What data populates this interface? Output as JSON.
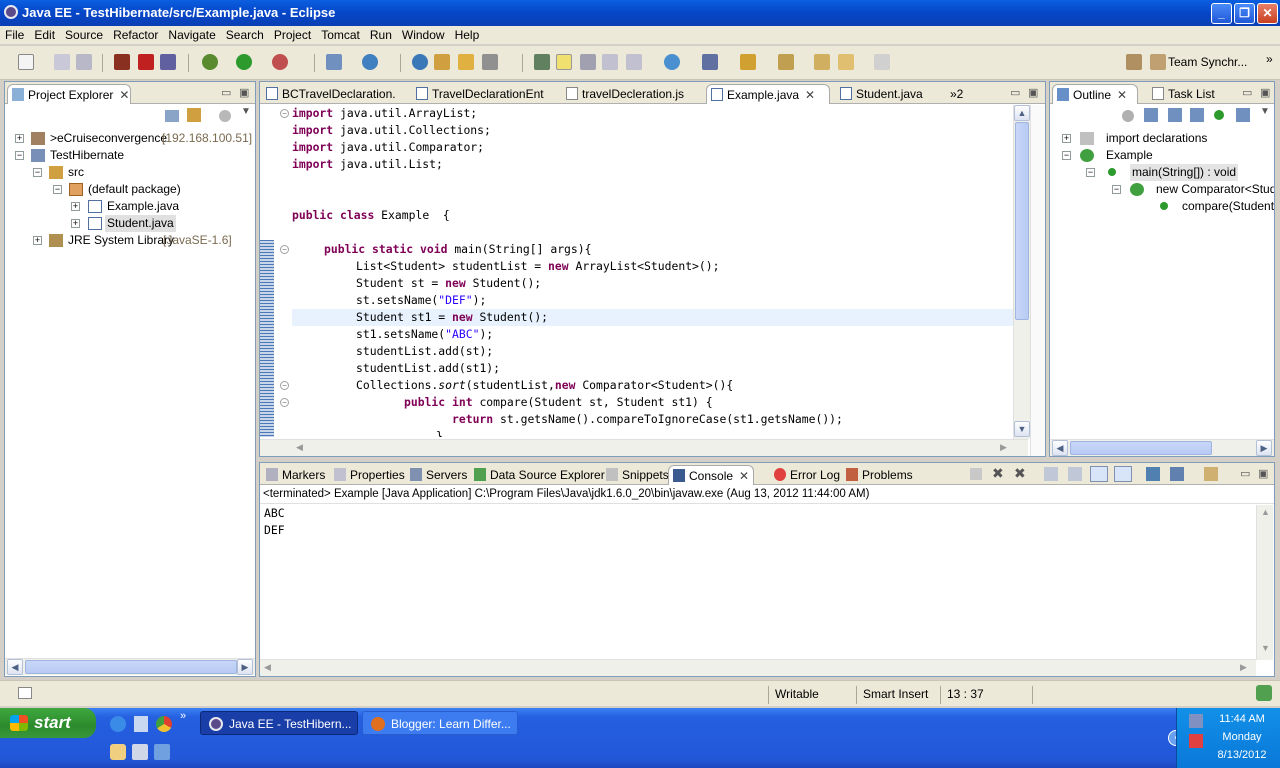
{
  "window": {
    "title": "Java EE - TestHibernate/src/Example.java - Eclipse"
  },
  "menu": [
    "File",
    "Edit",
    "Source",
    "Refactor",
    "Navigate",
    "Search",
    "Project",
    "Tomcat",
    "Run",
    "Window",
    "Help"
  ],
  "toolbar": {
    "team_sync": "Team Synchr..."
  },
  "project_explorer": {
    "title": "Project Explorer",
    "items": [
      {
        "label": ">eCruiseconvergence",
        "suffix": "[192.168.100.51]"
      },
      {
        "label": "TestHibernate"
      },
      {
        "label": "src"
      },
      {
        "label": "(default package)"
      },
      {
        "label": "Example.java"
      },
      {
        "label": "Student.java"
      },
      {
        "label": "JRE System Library",
        "suffix": "[JavaSE-1.6]"
      }
    ]
  },
  "editor_tabs": [
    {
      "label": "BCTravelDeclaration."
    },
    {
      "label": "TravelDeclarationEnt"
    },
    {
      "label": "travelDecleration.js"
    },
    {
      "label": "Example.java"
    },
    {
      "label": "Student.java"
    },
    {
      "label": "»2"
    }
  ],
  "code": {
    "l1a": "import",
    "l1b": " java.util.ArrayList;",
    "l2a": "import",
    "l2b": " java.util.Collections;",
    "l3a": "import",
    "l3b": " java.util.Comparator;",
    "l4a": "import",
    "l4b": " java.util.List;",
    "l6a": "public",
    "l6b": "class",
    "l6c": " Example  {",
    "l8a": "public",
    "l8b": "static",
    "l8c": "void",
    "l8d": " main(String[] args){",
    "l9a": "List<Student> studentList = ",
    "l9b": "new",
    "l9c": " ArrayList<Student>();",
    "l10a": "Student st = ",
    "l10b": "new",
    "l10c": " Student();",
    "l11a": "st.setsName(",
    "l11b": "\"DEF\"",
    "l11c": ");",
    "l12a": "Student st1 = ",
    "l12b": "new",
    "l12c": " Student();",
    "l13a": "st1.setsName(",
    "l13b": "\"ABC\"",
    "l13c": ");",
    "l14": "studentList.add(st);",
    "l15": "studentList.add(st1);",
    "l16a": "Collections.",
    "l16b": "sort",
    "l16c": "(studentList,",
    "l16d": "new",
    "l16e": " Comparator<Student>(){",
    "l17a": "public",
    "l17b": "int",
    "l17c": " compare(Student st, Student st1) {",
    "l18a": "return",
    "l18b": " st.getsName().compareToIgnoreCase(st1.getsName());",
    "l19": "}"
  },
  "outline": {
    "tab": "Outline",
    "tasklist": "Task List",
    "items": [
      {
        "label": "import declarations"
      },
      {
        "label": "Example"
      },
      {
        "label": "main(String[]) : void"
      },
      {
        "label": "new Comparator<Stude"
      },
      {
        "label": "compare(Student, S"
      }
    ]
  },
  "bottom_tabs": [
    "Markers",
    "Properties",
    "Servers",
    "Data Source Explorer",
    "Snippets",
    "Console",
    "Error Log",
    "Problems"
  ],
  "console": {
    "header": "<terminated> Example [Java Application] C:\\Program Files\\Java\\jdk1.6.0_20\\bin\\javaw.exe (Aug 13, 2012 11:44:00 AM)",
    "lines": [
      "ABC",
      "DEF"
    ]
  },
  "status": {
    "writable": "Writable",
    "insert": "Smart Insert",
    "position": "13 : 37"
  },
  "taskbar": {
    "start": "start",
    "tasks": [
      "Java EE - TestHibern...",
      "Blogger: Learn Differ..."
    ],
    "time": "11:44 AM",
    "day": "Monday",
    "date": "8/13/2012"
  }
}
